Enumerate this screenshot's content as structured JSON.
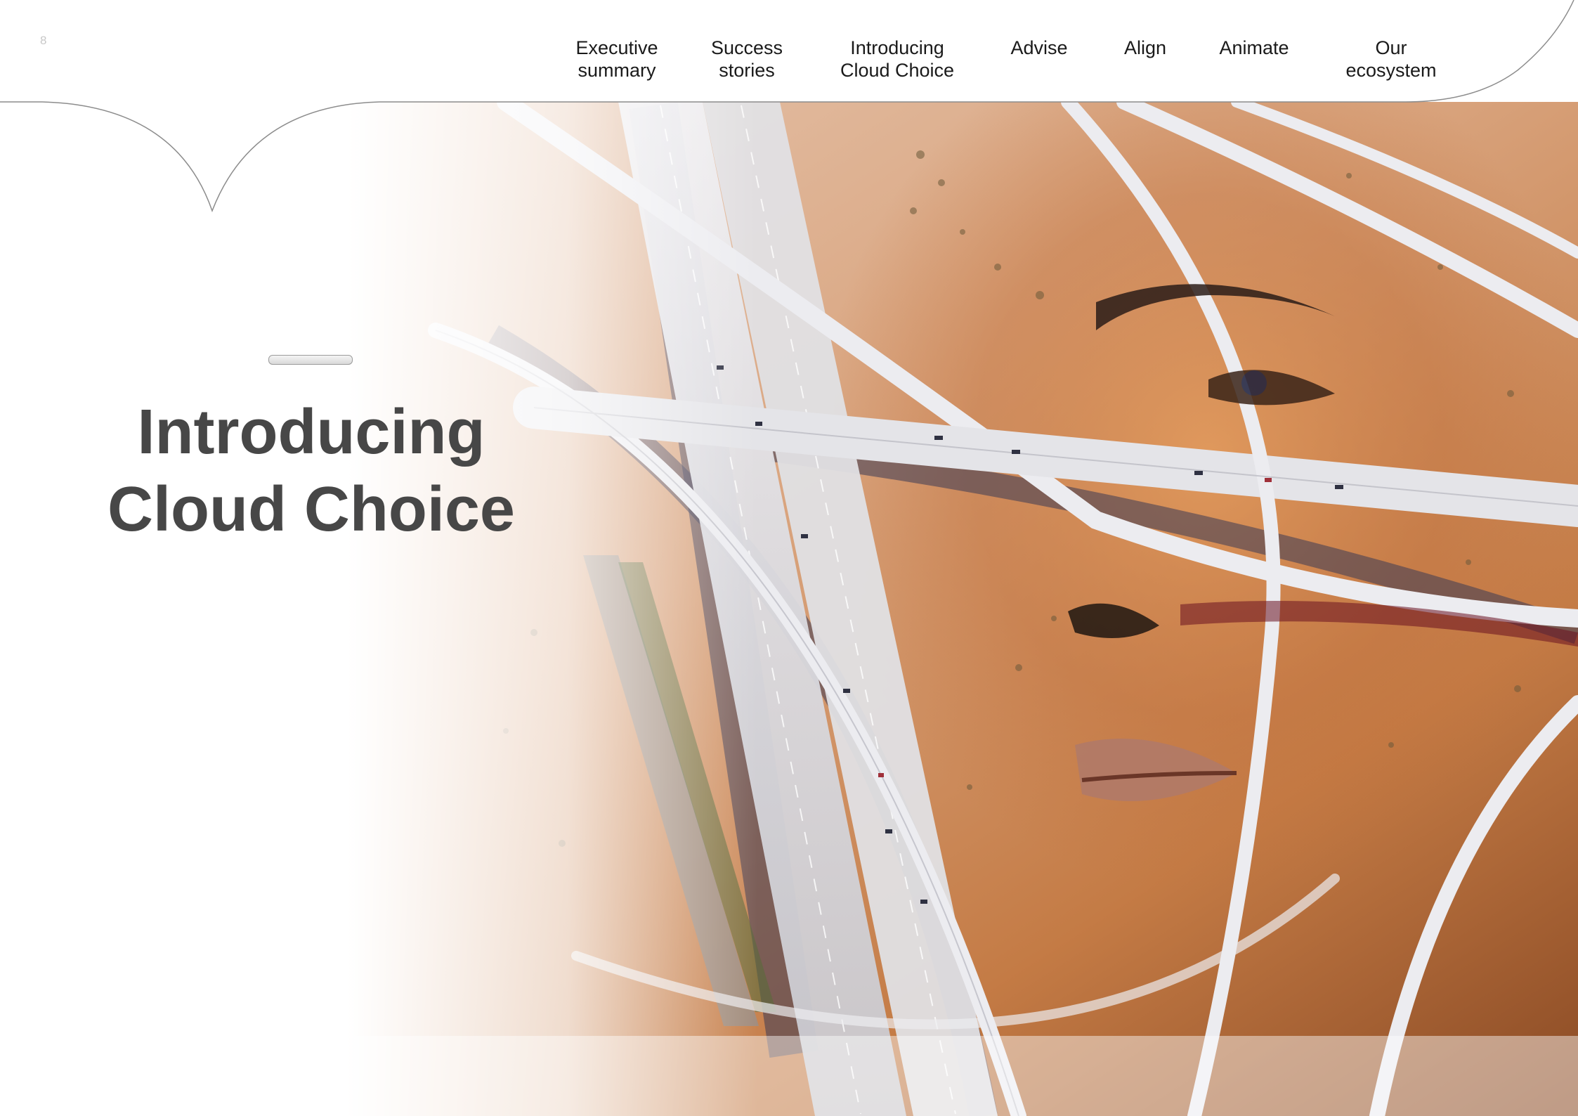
{
  "page": {
    "number": "8"
  },
  "nav": {
    "items": [
      {
        "id": "executive-summary",
        "label": "Executive\nsummary"
      },
      {
        "id": "success-stories",
        "label": "Success\nstories"
      },
      {
        "id": "introducing-cloud-choice",
        "label": "Introducing\nCloud Choice"
      },
      {
        "id": "advise",
        "label": "Advise"
      },
      {
        "id": "align",
        "label": "Align"
      },
      {
        "id": "animate",
        "label": "Animate"
      },
      {
        "id": "our-ecosystem",
        "label": "Our\necosystem"
      }
    ]
  },
  "hero": {
    "title": "Introducing\nCloud Choice"
  },
  "colors": {
    "title_text": "#474747",
    "nav_text": "#1a1a1a",
    "desert": "#c98a5c",
    "road": "#d9d9dc",
    "shadow": "#3b3a56"
  }
}
